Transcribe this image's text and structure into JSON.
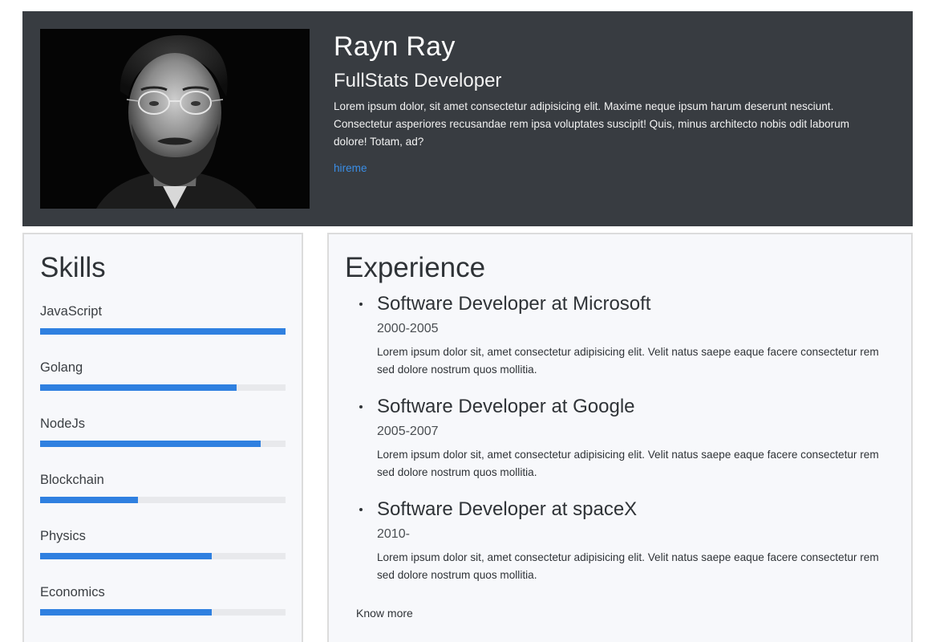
{
  "profile": {
    "name": "Rayn Ray",
    "role": "FullStats Developer",
    "bio": "Lorem ipsum dolor, sit amet consectetur adipisicing elit. Maxime neque ipsum harum deserunt nesciunt. Consectetur asperiores recusandae rem ipsa voluptates suscipit! Quis, minus architecto nobis odit laborum dolore! Totam, ad?",
    "hire_label": "hireme"
  },
  "skills": {
    "title": "Skills",
    "items": [
      {
        "label": "JavaScript",
        "level": 1.0
      },
      {
        "label": "Golang",
        "level": 0.8
      },
      {
        "label": "NodeJs",
        "level": 0.9
      },
      {
        "label": "Blockchain",
        "level": 0.4
      },
      {
        "label": "Physics",
        "level": 0.7
      },
      {
        "label": "Economics",
        "level": 0.7
      }
    ]
  },
  "experience": {
    "title": "Experience",
    "items": [
      {
        "title": "Software Developer at Microsoft",
        "years": "2000-2005",
        "description": "Lorem ipsum dolor sit, amet consectetur adipisicing elit. Velit natus saepe eaque facere consectetur rem sed dolore nostrum quos mollitia."
      },
      {
        "title": "Software Developer at Google",
        "years": "2005-2007",
        "description": "Lorem ipsum dolor sit, amet consectetur adipisicing elit. Velit natus saepe eaque facere consectetur rem sed dolore nostrum quos mollitia."
      },
      {
        "title": "Software Developer at spaceX",
        "years": "2010-",
        "description": "Lorem ipsum dolor sit, amet consectetur adipisicing elit. Velit natus saepe eaque facere consectetur rem sed dolore nostrum quos mollitia."
      }
    ],
    "know_more_label": "Know more"
  },
  "colors": {
    "header_bg": "#383c41",
    "accent": "#2f80e0",
    "link": "#3a8ee6",
    "card_bg": "#f7f8fb"
  }
}
